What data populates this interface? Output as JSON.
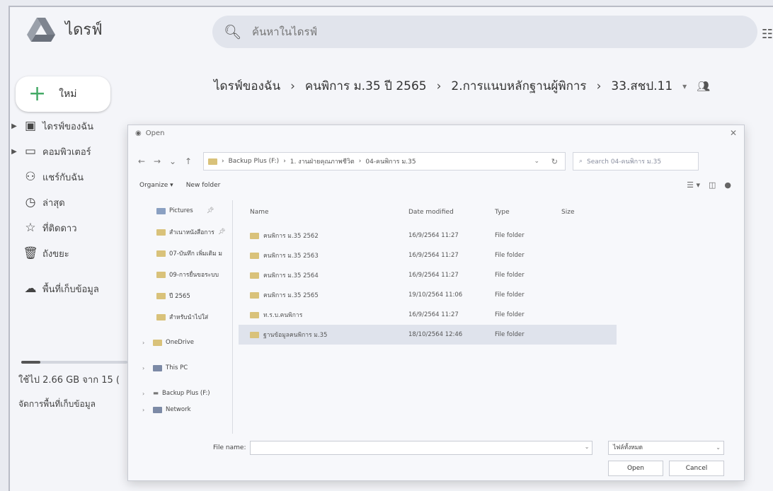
{
  "drive": {
    "title": "ไดรฟ์",
    "search_placeholder": "ค้นหาในไดรฟ์",
    "new_label": "ใหม่",
    "breadcrumb": [
      "ไดรฟ์ของฉัน",
      "คนพิการ ม.35 ปี 2565",
      "2.การแนบหลักฐานผู้พิการ",
      "33.สชป.11"
    ]
  },
  "sidebar": {
    "items": [
      {
        "label": "ไดรฟ์ของฉัน",
        "icon": "my-drive-icon"
      },
      {
        "label": "คอมพิวเตอร์",
        "icon": "computer-icon"
      },
      {
        "label": "แชร์กับฉัน",
        "icon": "shared-icon"
      },
      {
        "label": "ล่าสุด",
        "icon": "clock-icon"
      },
      {
        "label": "ที่ติดดาว",
        "icon": "star-icon"
      },
      {
        "label": "ถังขยะ",
        "icon": "trash-icon"
      },
      {
        "label": "พื้นที่เก็บข้อมูล",
        "icon": "cloud-icon"
      }
    ],
    "storage_text": "ใช้ไป 2.66 GB จาก 15 (",
    "storage_manage": "จัดการพื้นที่เก็บข้อมูล",
    "storage_fraction": 0.18
  },
  "dialog": {
    "title": "Open",
    "path": [
      "Backup Plus (F:)",
      "1. งานฝ่ายคุณภาพชีวิต",
      "04-คนพิการ ม.35"
    ],
    "search_placeholder": "Search 04-คนพิการ ม.35",
    "organize": "Organize ▾",
    "new_folder": "New folder",
    "nav_items": [
      {
        "label": "Pictures",
        "pinned": true
      },
      {
        "label": "สำเนาหนังสือการ",
        "pinned": true
      },
      {
        "label": "07-บันทึก เพิ่มเติม ม"
      },
      {
        "label": "09-การยื่นขอระบบ"
      },
      {
        "label": "ปี 2565"
      },
      {
        "label": "สำหรับนำไปใส่"
      },
      {
        "label": "OneDrive",
        "expandable": true
      },
      {
        "label": "This PC",
        "expandable": true
      },
      {
        "label": "Backup Plus (F:)",
        "expandable": true
      },
      {
        "label": "Network",
        "expandable": true
      }
    ],
    "columns": [
      "Name",
      "Date modified",
      "Type",
      "Size"
    ],
    "files": [
      {
        "name": "คนพิการ ม.35 2562",
        "date": "16/9/2564 11:27",
        "type": "File folder",
        "size": ""
      },
      {
        "name": "คนพิการ ม.35 2563",
        "date": "16/9/2564 11:27",
        "type": "File folder",
        "size": ""
      },
      {
        "name": "คนพิการ ม.35 2564",
        "date": "16/9/2564 11:27",
        "type": "File folder",
        "size": ""
      },
      {
        "name": "คนพิการ ม.35 2565",
        "date": "19/10/2564 11:06",
        "type": "File folder",
        "size": ""
      },
      {
        "name": "ท.ร.บ.คนพิการ",
        "date": "16/9/2564 11:27",
        "type": "File folder",
        "size": ""
      },
      {
        "name": "ฐานข้อมูลคนพิการ ม.35",
        "date": "18/10/2564 12:46",
        "type": "File folder",
        "size": ""
      }
    ],
    "filename_label": "File name:",
    "filename_value": "",
    "filetype": "ไฟล์ทั้งหมด",
    "open_label": "Open",
    "cancel_label": "Cancel"
  }
}
